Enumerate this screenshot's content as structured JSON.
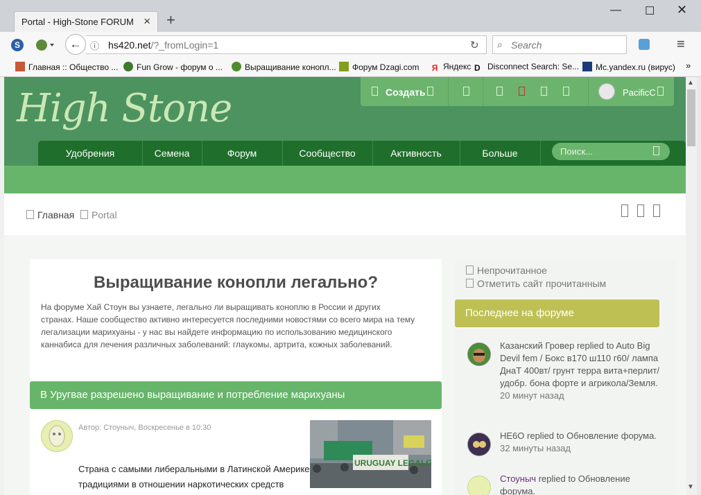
{
  "browser": {
    "tab_title": "Portal - High-Stone FORUM",
    "url_host": "hs420.net",
    "url_path": "/?_fromLogin=1",
    "search_placeholder": "Search",
    "bookmarks": [
      "Главная :: Общество ...",
      "Fun Grow - форум о ...",
      "Выращивание конопл...",
      "Форум Dzagi.com",
      "Яндекс",
      "Disconnect Search: Se...",
      "Mc.yandex.ru (вирус)"
    ]
  },
  "site": {
    "logo": "High Stone",
    "create_label": "Создать",
    "username": "PacificC",
    "nav": [
      "Удобрения",
      "Семена",
      "Форум",
      "Сообщество",
      "Активность",
      "Больше"
    ],
    "search_placeholder": "Поиск...",
    "breadcrumbs": [
      "Главная",
      "Portal"
    ]
  },
  "main": {
    "heading": "Выращивание конопли легально?",
    "intro": "На форуме Хай Стоун вы узнаете, легально ли выращивать коноплю в России и других странах. Наше сообщество активно интересуется последними новостями со всего мира на тему легализации марихуаны - у нас вы найдете информацию по использованию медицинского каннабиса для лечения различных заболеваний: глаукомы, артрита, кожных заболеваний.",
    "article_title": "В Уругвае разрешено выращивание и потребление марихуаны",
    "article_meta": "Автор: Стоуныч, Воскресенье в 10:30",
    "article_body": "Страна с самыми либеральными в Латинской Америке традициями в отношении наркотических средств",
    "photo_sign": "URUGUAY LEGALIZA"
  },
  "sidebar": {
    "links": [
      "Непрочитанное",
      "Отметить сайт прочитанным"
    ],
    "latest_title": "Последнее на форуме",
    "feed": [
      {
        "text": "Казанский Гровер replied to Auto Big Devil fem / Бокс в170 ш110 г60/ лампа ДнаТ 400вт/ грунт терра вита+перлит/ удобр. бона форте и агрикола/Земля.",
        "time": "20 минут назад"
      },
      {
        "text": "HE6O replied to Обновление форума.",
        "time": "32 минуты назад"
      },
      {
        "user": "Стоуныч",
        "text": " replied to Обновление форума.",
        "time": ""
      }
    ]
  },
  "colors": {
    "header_green": "#4d9360",
    "nav_green": "#1f6e2c",
    "light_green": "#67b56a",
    "olive": "#bfc054"
  }
}
